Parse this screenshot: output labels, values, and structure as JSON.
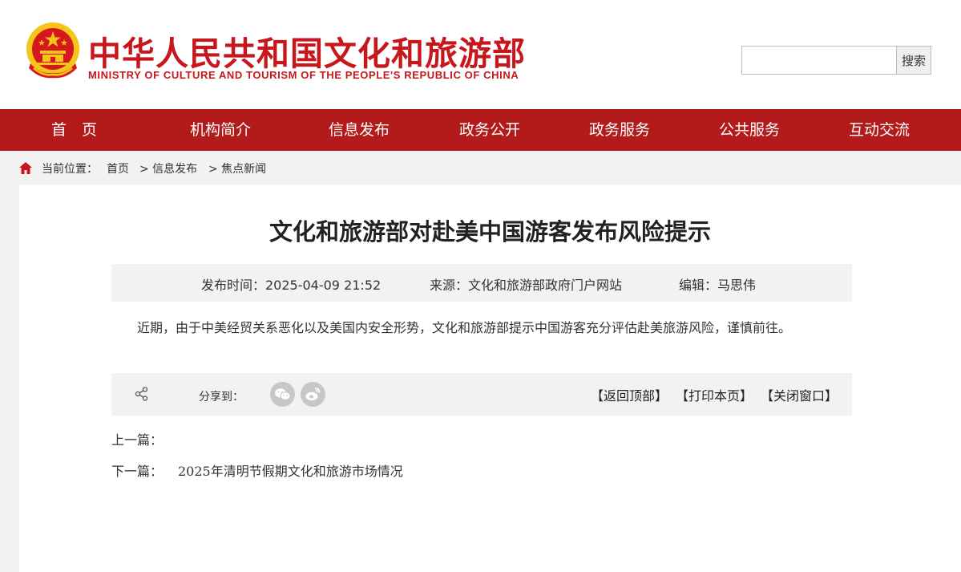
{
  "header": {
    "title_cn": "中华人民共和国文化和旅游部",
    "title_en": "MINISTRY OF CULTURE AND TOURISM OF THE PEOPLE'S REPUBLIC OF CHINA",
    "emblem_icon": "national-emblem-icon"
  },
  "search": {
    "placeholder": "",
    "value": "",
    "button_label": "搜索"
  },
  "nav": {
    "items": [
      {
        "label": "首　页"
      },
      {
        "label": "机构简介"
      },
      {
        "label": "信息发布"
      },
      {
        "label": "政务公开"
      },
      {
        "label": "政务服务"
      },
      {
        "label": "公共服务"
      },
      {
        "label": "互动交流"
      }
    ]
  },
  "breadcrumb": {
    "icon": "home-icon",
    "prefix": "当前位置：",
    "items": [
      "首页",
      "> 信息发布",
      "> 焦点新闻"
    ]
  },
  "article": {
    "title": "文化和旅游部对赴美中国游客发布风险提示",
    "meta": {
      "publish_time": "发布时间：2025-04-09 21:52",
      "source": "来源：文化和旅游部政府门户网站",
      "editor": "编辑：马思伟"
    },
    "body": "近期，由于中美经贸关系恶化以及美国内安全形势，文化和旅游部提示中国游客充分评估赴美旅游风险，谨慎前往。"
  },
  "share": {
    "icon": "share-icon",
    "label": "分享到：",
    "platforms": [
      "wechat-icon",
      "weibo-icon"
    ],
    "actions": [
      "【返回顶部】",
      "【打印本页】",
      "【关闭窗口】"
    ]
  },
  "navigation": {
    "prev_label": "上一篇：",
    "prev_title": "",
    "next_label": "下一篇：",
    "next_title": "2025年清明节假期文化和旅游市场情况"
  },
  "colors": {
    "brand_red": "#c8161d",
    "nav_bg": "#b31b1b",
    "page_bg": "#f2f2f2",
    "emblem_gold": "#f5c518"
  }
}
